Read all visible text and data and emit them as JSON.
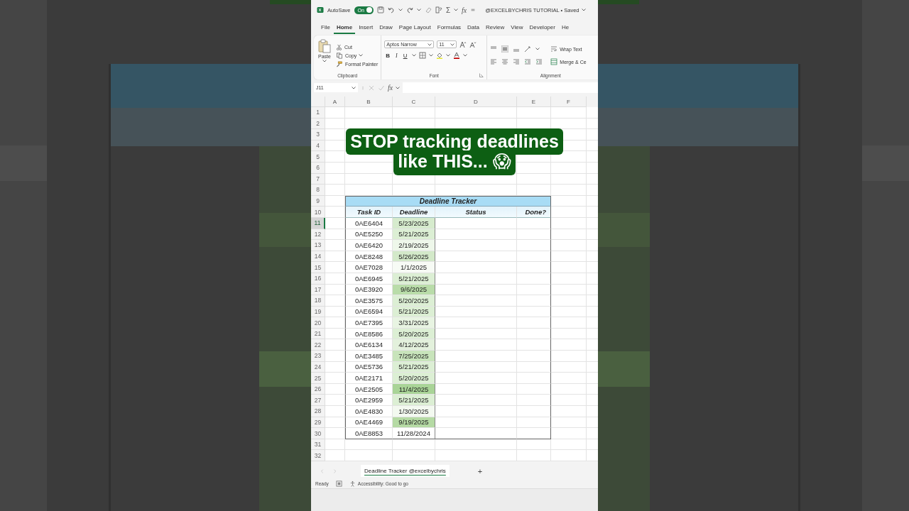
{
  "titlebar": {
    "autosave_label": "AutoSave",
    "autosave": {
      "label": "On",
      "on": true
    },
    "sum": "Σ",
    "function": "fx",
    "document": "@EXCELBYCHRIS TUTORIAL • Saved"
  },
  "menu_tabs": [
    {
      "label": "File",
      "selected": false
    },
    {
      "label": "Home",
      "selected": true
    },
    {
      "label": "Insert",
      "selected": false
    },
    {
      "label": "Draw",
      "selected": false
    },
    {
      "label": "Page Layout",
      "selected": false
    },
    {
      "label": "Formulas",
      "selected": false
    },
    {
      "label": "Data",
      "selected": false
    },
    {
      "label": "Review",
      "selected": false
    },
    {
      "label": "View",
      "selected": false
    },
    {
      "label": "Developer",
      "selected": false
    },
    {
      "label": "He",
      "selected": false
    }
  ],
  "ribbon": {
    "clipboard": {
      "paste": "Paste",
      "cut": "Cut",
      "copy": "Copy",
      "format_painter": "Format Painter",
      "label": "Clipboard"
    },
    "font": {
      "family": "Aptos Narrow",
      "size": "11",
      "bold": "B",
      "italic": "I",
      "underline": "U",
      "label": "Font"
    },
    "alignment": {
      "wrap": "Wrap Text",
      "merge": "Merge & Ce",
      "label": "Alignment"
    }
  },
  "formula_bar": {
    "name_box": "J11",
    "function": "fx"
  },
  "columns": [
    "A",
    "B",
    "C",
    "D",
    "E",
    "F"
  ],
  "row_numbers": [
    {
      "label": "1",
      "selected": false
    },
    {
      "label": "2",
      "selected": false
    },
    {
      "label": "3",
      "selected": false
    },
    {
      "label": "4",
      "selected": false
    },
    {
      "label": "5",
      "selected": false
    },
    {
      "label": "6",
      "selected": false
    },
    {
      "label": "7",
      "selected": false
    },
    {
      "label": "8",
      "selected": false
    },
    {
      "label": "9",
      "selected": false
    },
    {
      "label": "10",
      "selected": false
    },
    {
      "label": "11",
      "selected": true
    },
    {
      "label": "12",
      "selected": false
    },
    {
      "label": "13",
      "selected": false
    },
    {
      "label": "14",
      "selected": false
    },
    {
      "label": "15",
      "selected": false
    },
    {
      "label": "16",
      "selected": false
    },
    {
      "label": "17",
      "selected": false
    },
    {
      "label": "18",
      "selected": false
    },
    {
      "label": "19",
      "selected": false
    },
    {
      "label": "20",
      "selected": false
    },
    {
      "label": "21",
      "selected": false
    },
    {
      "label": "22",
      "selected": false
    },
    {
      "label": "23",
      "selected": false
    },
    {
      "label": "24",
      "selected": false
    },
    {
      "label": "25",
      "selected": false
    },
    {
      "label": "26",
      "selected": false
    },
    {
      "label": "27",
      "selected": false
    },
    {
      "label": "28",
      "selected": false
    },
    {
      "label": "29",
      "selected": false
    },
    {
      "label": "30",
      "selected": false
    },
    {
      "label": "31",
      "selected": false
    },
    {
      "label": "32",
      "selected": false
    }
  ],
  "caption": {
    "lines": [
      "STOP tracking deadlines",
      "like THIS... 😱"
    ]
  },
  "tracker": {
    "title": "Deadline Tracker",
    "columns": [
      "Task ID",
      "Deadline",
      "Status",
      "Done?"
    ],
    "rows": [
      {
        "task_id": "0AE6404",
        "deadline": "5/23/2025",
        "color": "#d6ebcd"
      },
      {
        "task_id": "0AE5250",
        "deadline": "5/21/2025",
        "color": "#dcefd4"
      },
      {
        "task_id": "0AE6420",
        "deadline": "2/19/2025",
        "color": "#eef7ea"
      },
      {
        "task_id": "0AE8248",
        "deadline": "5/26/2025",
        "color": "#d3e9c9"
      },
      {
        "task_id": "0AE7028",
        "deadline": "1/1/2025",
        "color": "#f7fbf5"
      },
      {
        "task_id": "0AE6945",
        "deadline": "5/21/2025",
        "color": "#dcefd4"
      },
      {
        "task_id": "0AE3920",
        "deadline": "9/6/2025",
        "color": "#b9dca9"
      },
      {
        "task_id": "0AE3575",
        "deadline": "5/20/2025",
        "color": "#dcefd4"
      },
      {
        "task_id": "0AE6594",
        "deadline": "5/21/2025",
        "color": "#dcefd4"
      },
      {
        "task_id": "0AE7395",
        "deadline": "3/31/2025",
        "color": "#e8f4e2"
      },
      {
        "task_id": "0AE8586",
        "deadline": "5/20/2025",
        "color": "#dcefd4"
      },
      {
        "task_id": "0AE6134",
        "deadline": "4/12/2025",
        "color": "#e3f1dc"
      },
      {
        "task_id": "0AE3485",
        "deadline": "7/25/2025",
        "color": "#c8e4bb"
      },
      {
        "task_id": "0AE5736",
        "deadline": "5/21/2025",
        "color": "#dcefd4"
      },
      {
        "task_id": "0AE2171",
        "deadline": "5/20/2025",
        "color": "#dcefd4"
      },
      {
        "task_id": "0AE2505",
        "deadline": "11/4/2025",
        "color": "#a9d497"
      },
      {
        "task_id": "0AE2959",
        "deadline": "5/21/2025",
        "color": "#dcefd4"
      },
      {
        "task_id": "0AE4830",
        "deadline": "1/30/2025",
        "color": "#f3f9f0"
      },
      {
        "task_id": "0AE4469",
        "deadline": "9/19/2025",
        "color": "#b5daa4"
      },
      {
        "task_id": "0AE8853",
        "deadline": "11/28/2024",
        "color": "#ffffff"
      }
    ]
  },
  "sheet_tabs": [
    {
      "label": "Deadline Tracker @excelbychris",
      "selected": true
    }
  ],
  "add_sheet": "+",
  "status_bar": {
    "ready": "Ready",
    "accessibility": "Accessibility: Good to go"
  }
}
